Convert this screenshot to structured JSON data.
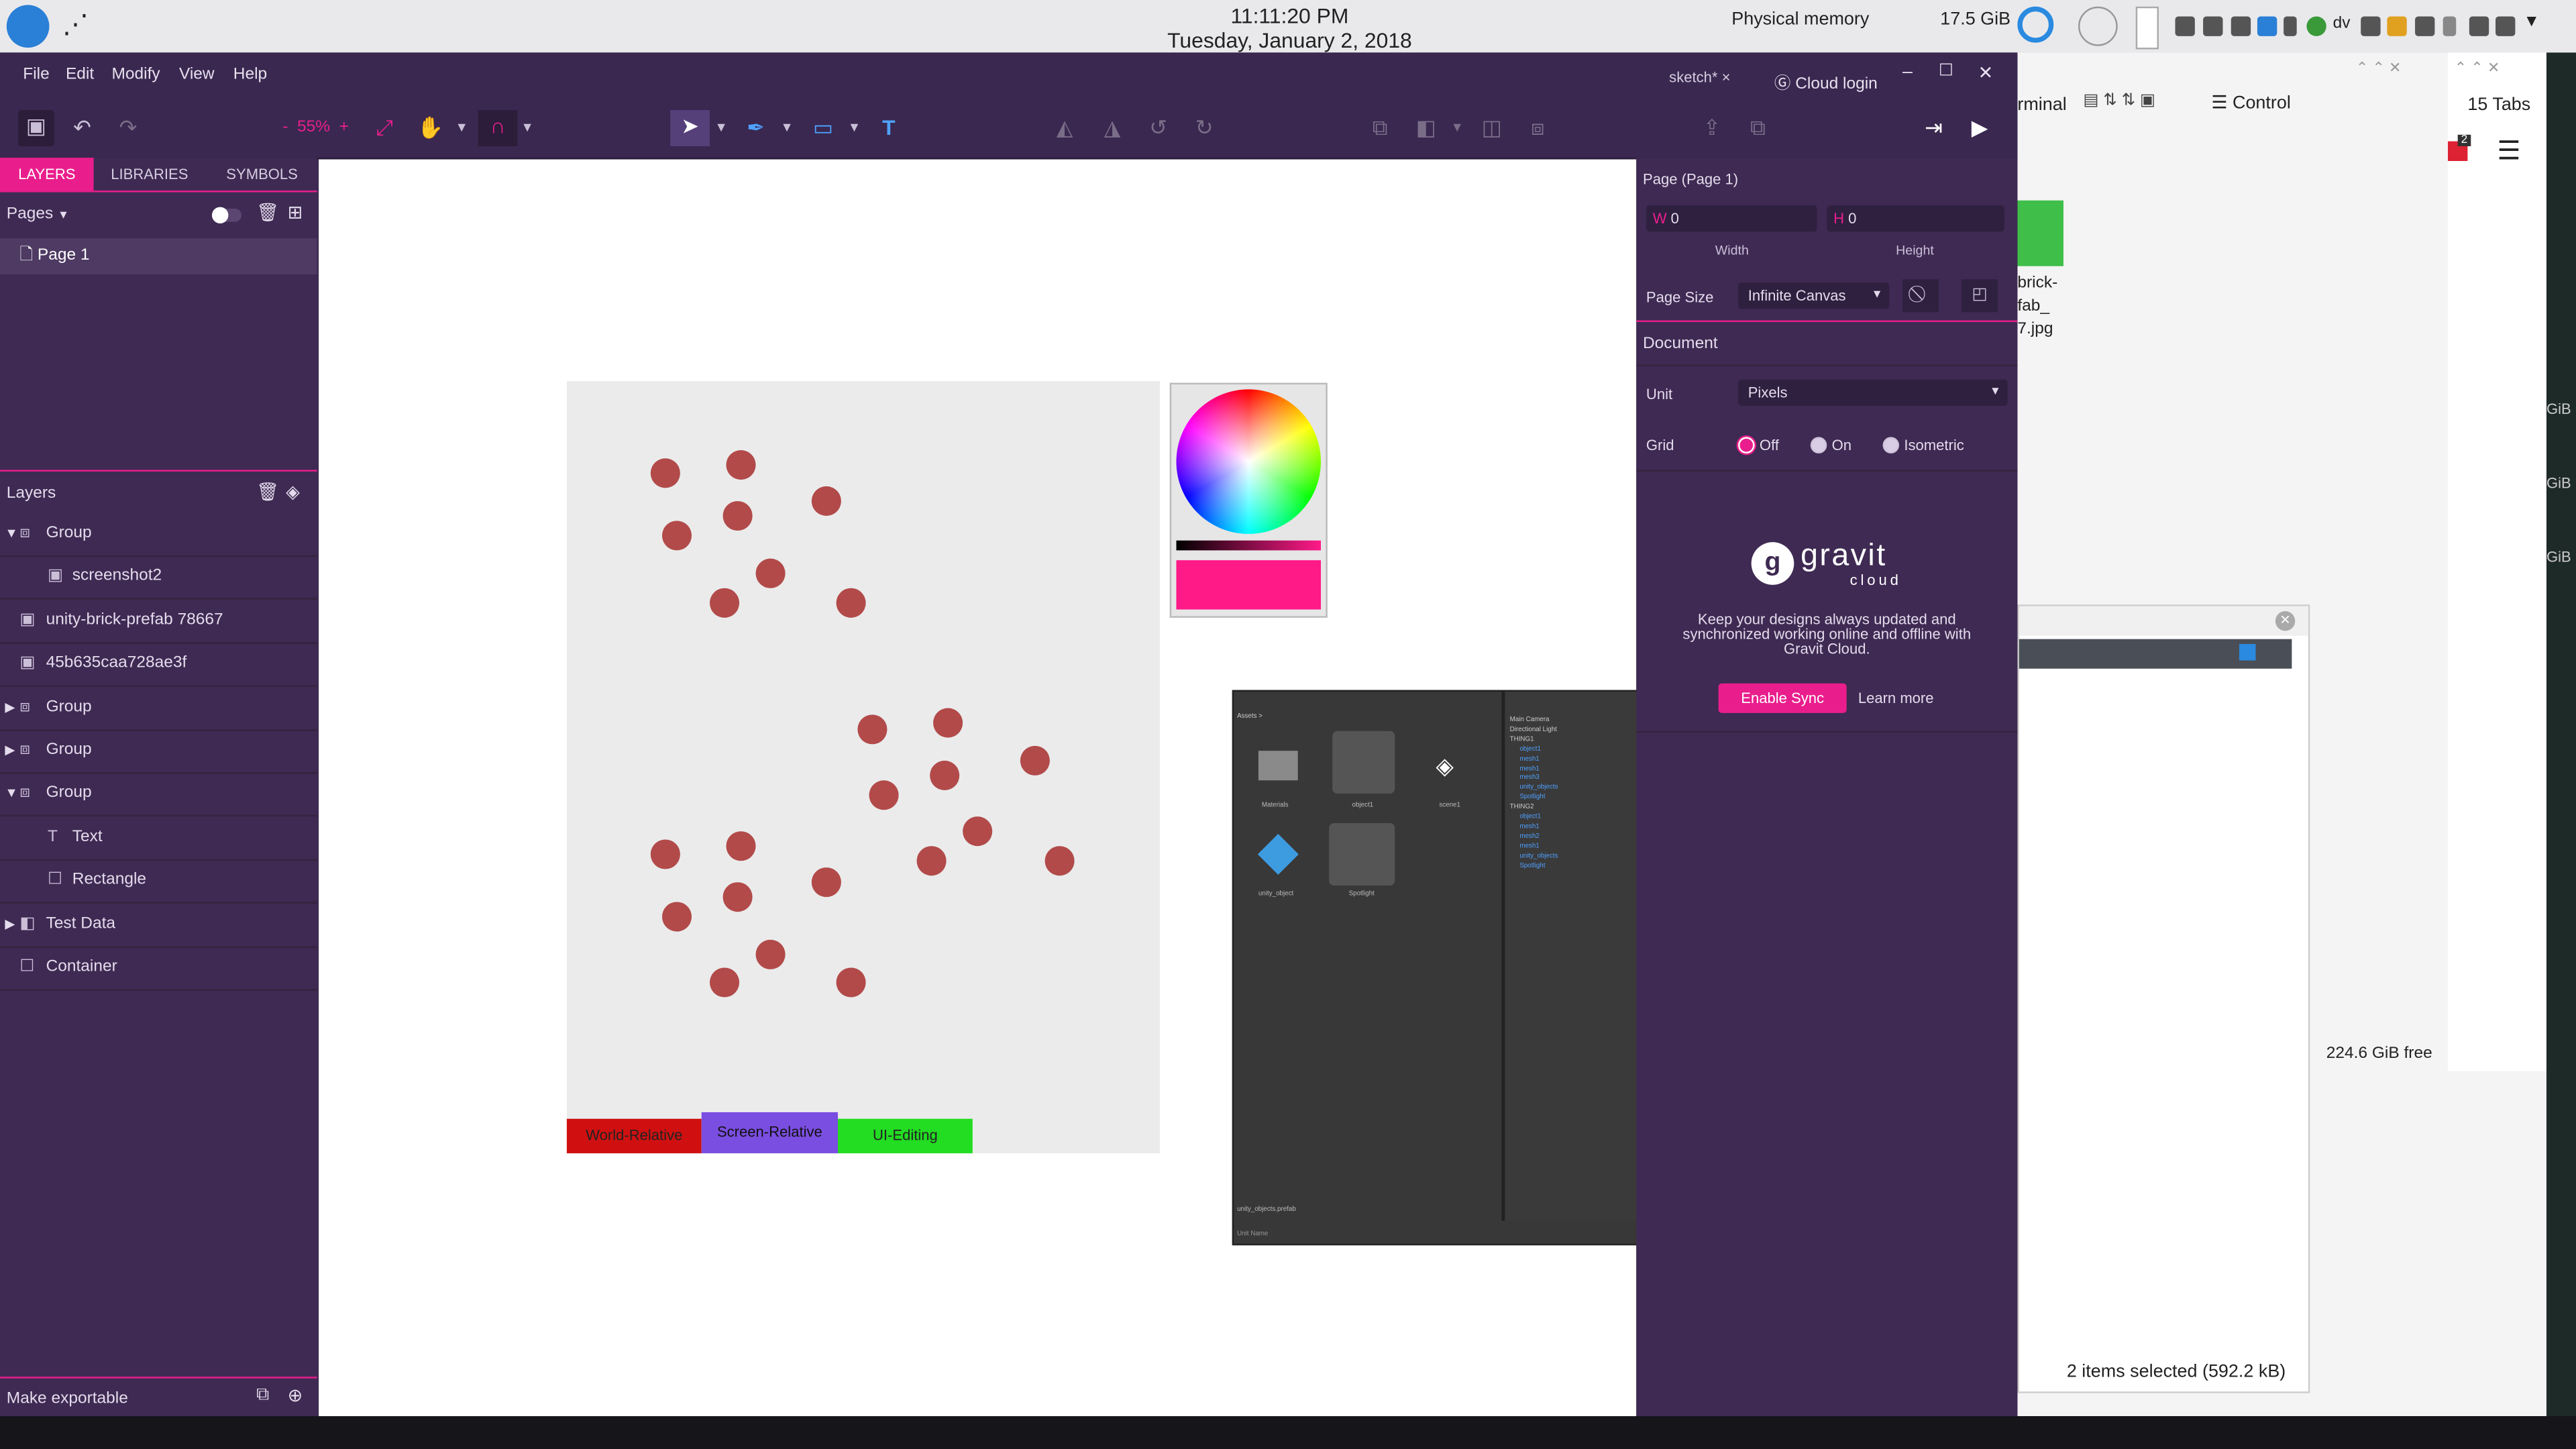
{
  "system": {
    "time": "11:11:20 PM",
    "date": "Tuesday, January 2, 2018",
    "memory_label": "Physical memory",
    "memory_value": "17.5 GiB",
    "kb_label": "dv",
    "tray_icons": [
      "fileman-icon",
      "clipboard-icon",
      "monitor-icon",
      "network-icon",
      "bluetooth-icon",
      "chrome-icon",
      "folder-icon",
      "notes-icon",
      "screenshot-icon",
      "usb-icon",
      "clipboard2-icon",
      "volume-icon",
      "chevron-down-icon"
    ]
  },
  "background": {
    "terminal_partial": "rminal",
    "control_label": "Control",
    "tabs_label": "15 Tabs",
    "badge_count": "2",
    "file_name_lines": [
      "brick-",
      "fab_",
      "7.jpg"
    ],
    "free_space": "224.6 GiB free",
    "selection_status": "2 items selected (592.2 kB)",
    "gib_labels": [
      "GiB",
      "GiB",
      "GiB"
    ]
  },
  "app": {
    "menu": [
      "File",
      "Edit",
      "Modify",
      "View",
      "Help"
    ],
    "doc_tab": "sketch*",
    "cloud_login": "Cloud login",
    "zoom": "55%",
    "zoom_minus": "-",
    "zoom_plus": "+"
  },
  "left_panel": {
    "tabs": [
      "LAYERS",
      "LIBRARIES",
      "SYMBOLS"
    ],
    "pages_label": "Pages",
    "pages": [
      "Page 1"
    ],
    "layers_label": "Layers",
    "layers": [
      {
        "label": "Group",
        "indent": 0,
        "expander": "open",
        "icon": "group-icon"
      },
      {
        "label": "screenshot2",
        "indent": 1,
        "expander": "",
        "icon": "image-icon"
      },
      {
        "label": "unity-brick-prefab 78667",
        "indent": 0,
        "expander": "",
        "icon": "image-icon"
      },
      {
        "label": "45b635caa728ae3f",
        "indent": 0,
        "expander": "",
        "icon": "image-icon"
      },
      {
        "label": "Group",
        "indent": 0,
        "expander": "closed",
        "icon": "group-icon"
      },
      {
        "label": "Group",
        "indent": 0,
        "expander": "closed",
        "icon": "group-icon"
      },
      {
        "label": "Group",
        "indent": 0,
        "expander": "open",
        "icon": "group-icon"
      },
      {
        "label": "Text",
        "indent": 1,
        "expander": "",
        "icon": "text-icon"
      },
      {
        "label": "Rectangle",
        "indent": 1,
        "expander": "",
        "icon": "rectangle-icon"
      },
      {
        "label": "Test Data",
        "indent": 0,
        "expander": "closed",
        "icon": "symbol-icon"
      },
      {
        "label": "Container",
        "indent": 0,
        "expander": "",
        "icon": "rectangle-icon"
      }
    ],
    "make_exportable": "Make exportable"
  },
  "canvas": {
    "buttons": [
      "World-Relative",
      "Screen-Relative",
      "UI-Editing"
    ],
    "button_colors": [
      "#d01010",
      "#7a4ee0",
      "#22dd22"
    ],
    "swatch_color": "#ff1a88",
    "dot_color": "#b24a4a"
  },
  "embedded_screenshot": {
    "assets_label": "Assets >",
    "asset_labels": [
      "Materials",
      "object1",
      "scene1",
      "unity_object",
      "Spotlight"
    ],
    "hierarchy": [
      "Main Camera",
      "Directional Light",
      "THING1",
      "object1",
      "mesh1",
      "mesh1",
      "mesh3",
      "unity_objects",
      "Spotlight",
      "THING2",
      "object1",
      "mesh1",
      "mesh2",
      "mesh1",
      "unity_objects",
      "Spotlight"
    ],
    "footer": "unity_objects.prefab",
    "status": "Unit Name"
  },
  "right_panel": {
    "page_title": "Page (Page 1)",
    "width_prefix": "W",
    "width_value": "0",
    "height_prefix": "H",
    "height_value": "0",
    "width_label": "Width",
    "height_label": "Height",
    "page_size_label": "Page Size",
    "page_size_value": "Infinite Canvas",
    "document_label": "Document",
    "unit_label": "Unit",
    "unit_value": "Pixels",
    "grid_label": "Grid",
    "grid_options": [
      "Off",
      "On",
      "Isometric"
    ],
    "grid_selected": "Off",
    "gravit_word": "gravit",
    "cloud_word": "cloud",
    "promo_text": "Keep your designs always updated and synchronized working online and offline with Gravit Cloud.",
    "enable_sync": "Enable Sync",
    "learn_more": "Learn more"
  }
}
